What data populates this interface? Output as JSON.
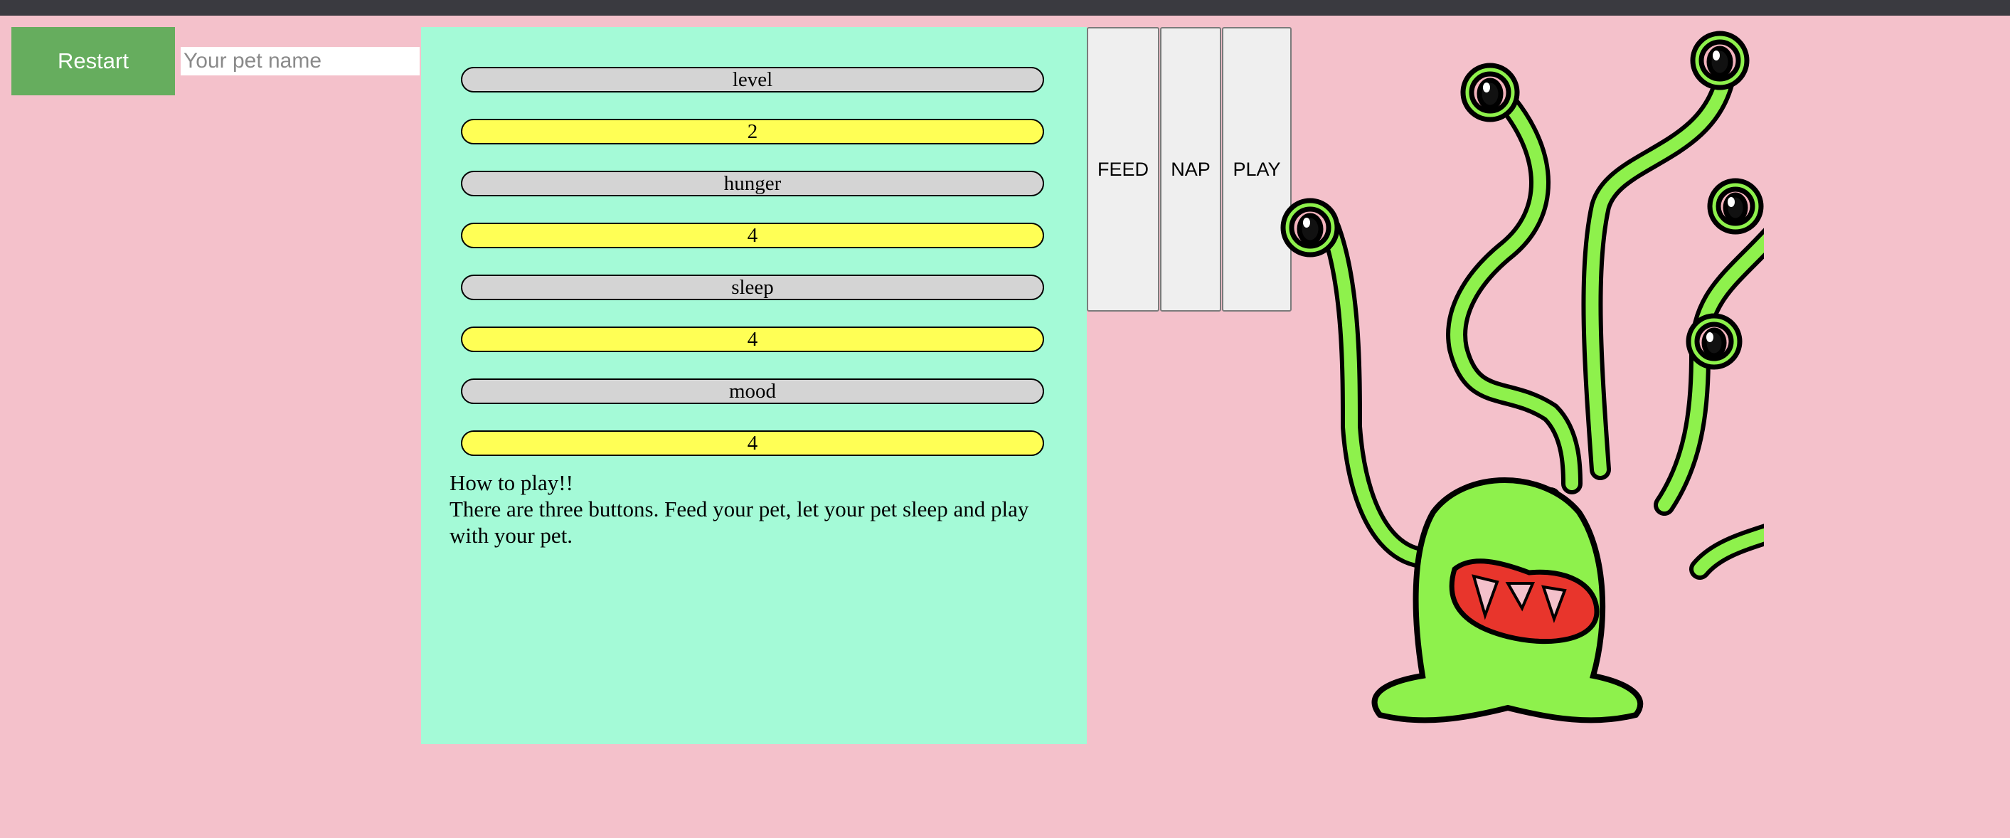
{
  "controls": {
    "restart_label": "Restart",
    "name_placeholder": "Your pet name",
    "name_value": ""
  },
  "stats": [
    {
      "label": "level",
      "value": "2"
    },
    {
      "label": "hunger",
      "value": "4"
    },
    {
      "label": "sleep",
      "value": "4"
    },
    {
      "label": "mood",
      "value": "4"
    }
  ],
  "instructions": {
    "title": "How to play!!",
    "body": "There are three buttons. Feed your pet, let your pet sleep and play with your pet."
  },
  "actions": {
    "feed": "FEED",
    "nap": "NAP",
    "play": "PLAY"
  },
  "pet_image": {
    "icon": "green-alien-monster-icon",
    "body_color": "#8ef14c",
    "mouth_color": "#e8352c",
    "eye_ring_color": "#f3b3bd"
  },
  "colors": {
    "background": "#f4c1cb",
    "panel": "#a4fad7",
    "restart": "#66ad5e",
    "stat_label": "#d4d4d4",
    "stat_value": "#ffff55"
  }
}
